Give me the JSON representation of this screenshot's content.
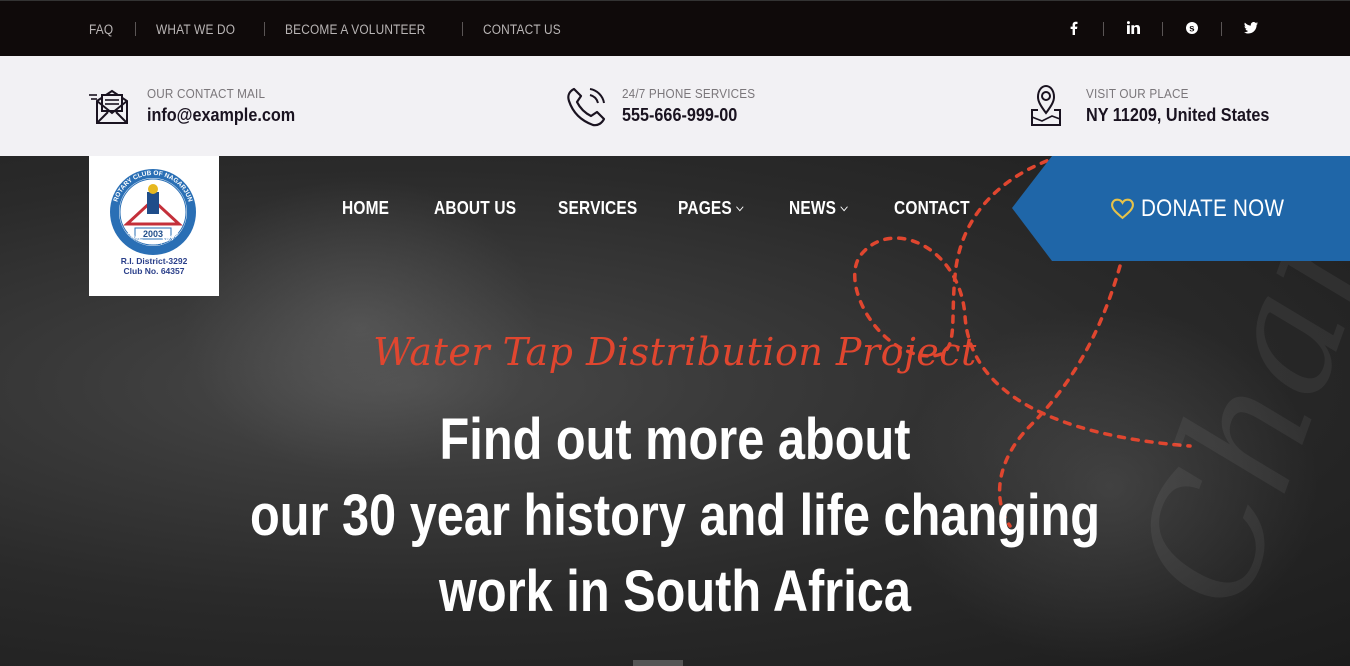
{
  "topbar": {
    "links": [
      "FAQ",
      "WHAT WE DO",
      "BECOME A VOLUNTEER",
      "CONTACT US"
    ],
    "social_icons": [
      "facebook-icon",
      "linkedin-icon",
      "skype-icon",
      "twitter-icon"
    ]
  },
  "contact": {
    "mail_label": "OUR CONTACT MAIL",
    "mail_value": "info@example.com",
    "phone_label": "24/7 PHONE SERVICES",
    "phone_value": "555-666-999-00",
    "place_label": "VISIT OUR PLACE",
    "place_value": "NY 11209, United States"
  },
  "logo": {
    "ring_text": "ROTARY CLUB OF NAGARJUN",
    "bottom_ring_text": "Kathmandu, Nepal",
    "year": "2003",
    "district": "R.I. District-3292",
    "club_no": "Club No. 64357"
  },
  "nav": {
    "items": [
      "HOME",
      "ABOUT US",
      "SERVICES",
      "PAGES",
      "NEWS",
      "CONTACT"
    ]
  },
  "donate": {
    "label": "DONATE NOW",
    "color": "#1f66a8",
    "icon": "heart-icon"
  },
  "hero": {
    "script_title": "Water Tap Distribution Project",
    "headline_lines": [
      "Find out more about",
      "our 30 year history and life changing",
      "work in South Africa"
    ],
    "accent_color": "#e0462f"
  }
}
